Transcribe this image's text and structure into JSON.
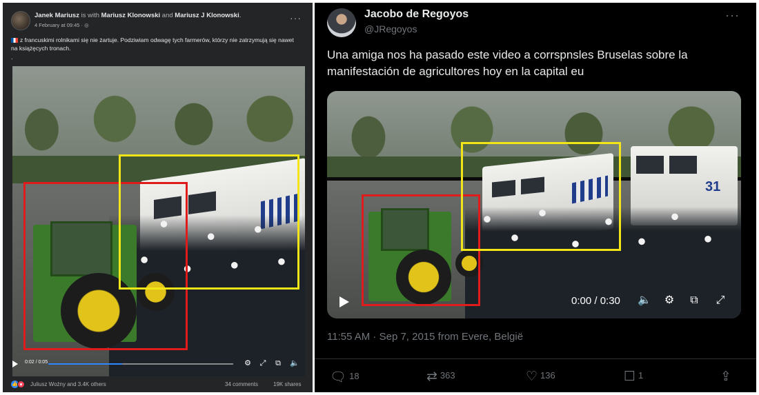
{
  "facebook_post": {
    "author": "Janek Mariusz",
    "with_text": "is with",
    "tagged_1": "Mariusz Klonowski",
    "and_text": "and",
    "tagged_2": "Mariusz J Klonowski",
    "date": "4 February at 09:45 · ",
    "more": "···",
    "text": "z francuskimi rolnikami się nie żartuje. Podziwiam odwagę tych farmerów, którzy nie zatrzymują się nawet na książęcych tronach.",
    "dot": ".",
    "video": {
      "time": "0:02 / 0:05",
      "progress": 0.4
    },
    "reactions_text": "Juliusz Woźny and 3.4K others",
    "comments": "34 comments",
    "shares": "19K shares"
  },
  "tweet": {
    "name": "Jacobo de Regoyos",
    "handle": "@JRegoyos",
    "more": "···",
    "text": "Una amiga nos ha pasado este video a corrspnsles Bruselas sobre la manifestación de agricultores hoy en la capital eu",
    "video": {
      "time": "0:00 / 0:30",
      "truck_number": "31"
    },
    "meta": "11:55 AM · Sep 7, 2015 from Evere, België",
    "replies": "18",
    "retweets": "363",
    "likes": "136",
    "bookmarks": "1"
  },
  "annotation_colors": {
    "tractor_box": "#e01b1b",
    "truck_box": "#f3e618"
  }
}
